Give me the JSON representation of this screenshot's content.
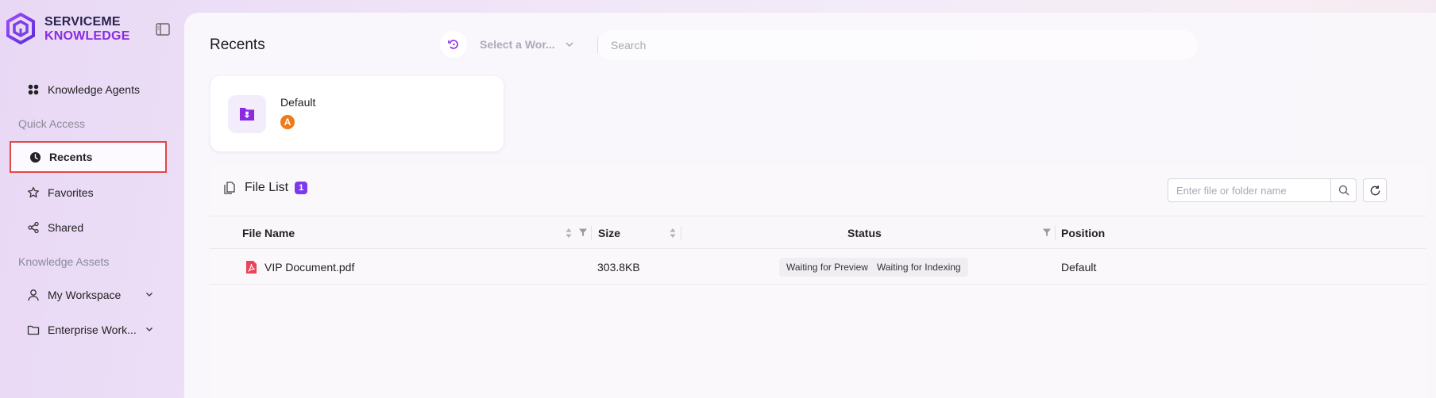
{
  "brand": {
    "line1": "SERVICEME",
    "line2": "KNOWLEDGE",
    "primary": "#8a2be2",
    "dark": "#2a2250"
  },
  "sidebar": {
    "agents_label": "Knowledge Agents",
    "quick_access_label": "Quick Access",
    "recents_label": "Recents",
    "favorites_label": "Favorites",
    "shared_label": "Shared",
    "assets_label": "Knowledge Assets",
    "my_workspace_label": "My Workspace",
    "enterprise_label": "Enterprise Work..."
  },
  "header": {
    "title": "Recents",
    "workspace_placeholder": "Select a Wor...",
    "search_placeholder": "Search"
  },
  "knowledge_card": {
    "name": "Default",
    "avatar_letter": "A",
    "avatar_color": "#f07a1a"
  },
  "file_list": {
    "title": "File List",
    "count": "1",
    "search_placeholder": "Enter file or folder name",
    "columns": {
      "name": "File Name",
      "size": "Size",
      "status": "Status",
      "position": "Position"
    },
    "rows": [
      {
        "name": "VIP Document.pdf",
        "size": "303.8KB",
        "status_preview": "Waiting for Preview",
        "status_indexing": "Waiting for Indexing",
        "position": "Default"
      }
    ]
  }
}
